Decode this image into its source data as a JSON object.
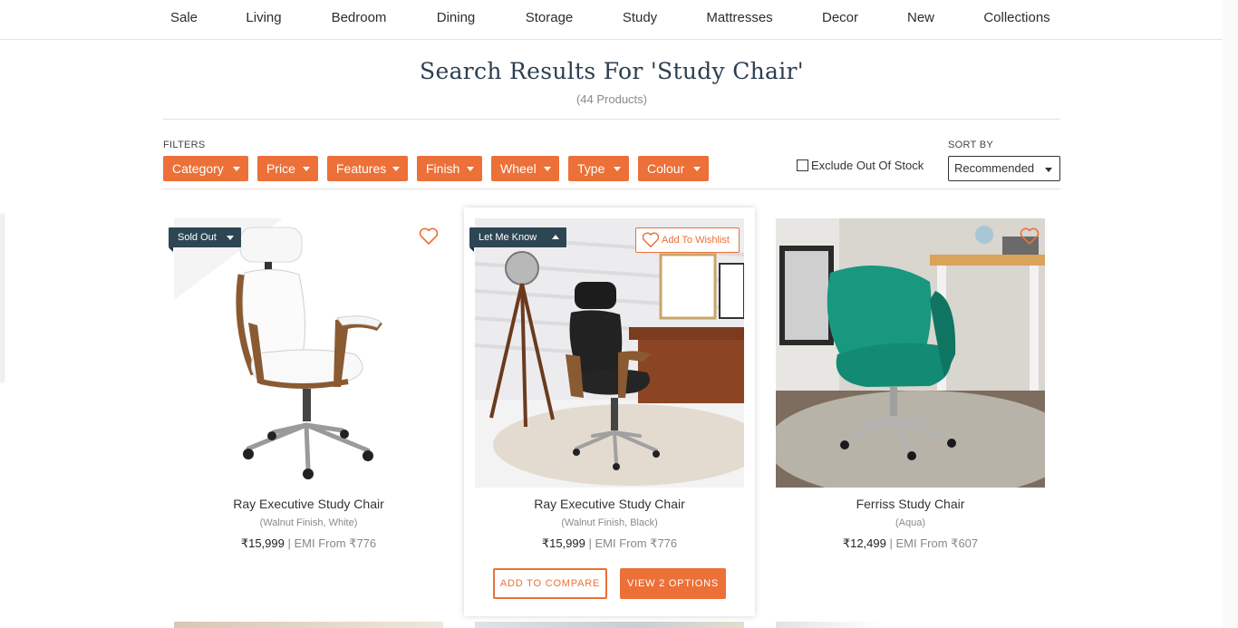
{
  "nav": [
    "Sale",
    "Living",
    "Bedroom",
    "Dining",
    "Storage",
    "Study",
    "Mattresses",
    "Decor",
    "New",
    "Collections"
  ],
  "search": {
    "heading": "Search Results For 'Study Chair'",
    "count": "(44 Products)"
  },
  "filters": {
    "label": "FILTERS",
    "buttons": [
      "Category",
      "Price",
      "Features",
      "Finish",
      "Wheel",
      "Type",
      "Colour"
    ]
  },
  "exclude_out_of_stock": {
    "label": "Exclude Out Of Stock",
    "checked": false
  },
  "sort": {
    "label": "SORT BY",
    "value": "Recommended"
  },
  "products": [
    {
      "name": "Ray Executive Study Chair",
      "variant": "(Walnut Finish, White)",
      "price": "₹15,999",
      "emi": "EMI From ₹776",
      "badge": "Sold Out"
    },
    {
      "name": "Ray Executive Study Chair",
      "variant": "(Walnut Finish, Black)",
      "price": "₹15,999",
      "emi": "EMI From ₹776",
      "badge": "Let Me Know",
      "wishlist": "Add To Wishlist",
      "compare": "ADD TO COMPARE",
      "options": "VIEW 2 OPTIONS"
    },
    {
      "name": "Ferriss Study Chair",
      "variant": "(Aqua)",
      "price": "₹12,499",
      "emi": "EMI From ₹607"
    }
  ],
  "colors": {
    "accent": "#ec7038",
    "badge": "#2e4654",
    "heading": "#2c3e50"
  }
}
